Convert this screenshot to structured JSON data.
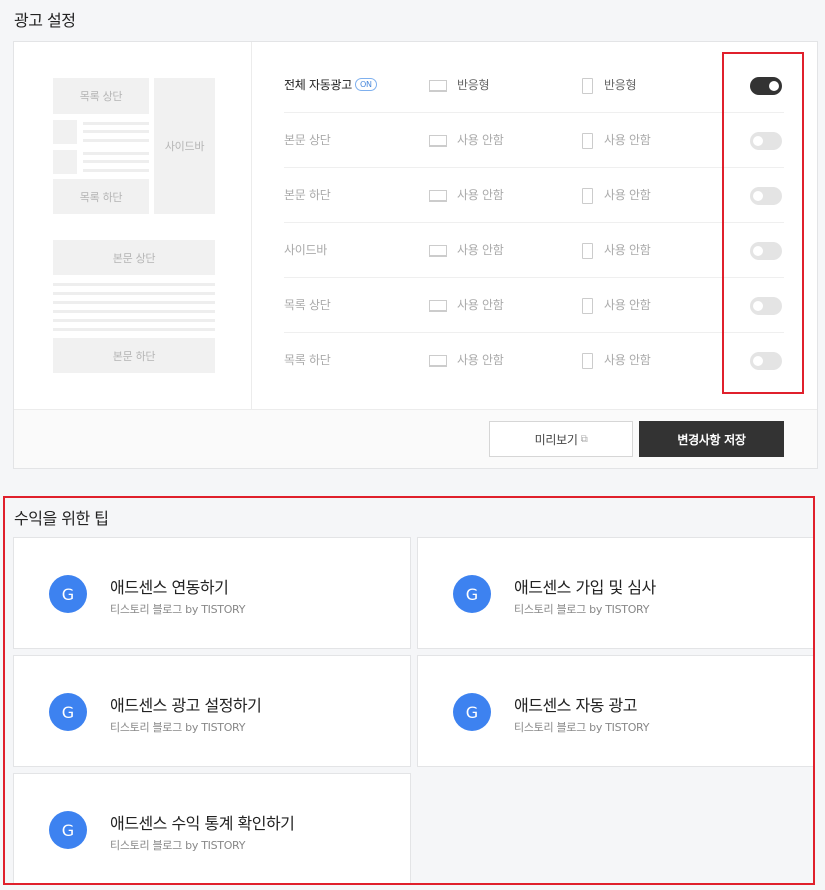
{
  "ad_settings": {
    "title": "광고 설정",
    "preview": {
      "list_top": "목록 상단",
      "list_bottom": "목록 하단",
      "sidebar": "사이드바",
      "body_top": "본문 상단",
      "body_bottom": "본문 하단"
    },
    "rows": [
      {
        "label": "전체 자동광고",
        "badge": "ON",
        "pc": "반응형",
        "mobile": "반응형",
        "enabled": true
      },
      {
        "label": "본문 상단",
        "pc": "사용 안함",
        "mobile": "사용 안함",
        "enabled": false
      },
      {
        "label": "본문 하단",
        "pc": "사용 안함",
        "mobile": "사용 안함",
        "enabled": false
      },
      {
        "label": "사이드바",
        "pc": "사용 안함",
        "mobile": "사용 안함",
        "enabled": false
      },
      {
        "label": "목록 상단",
        "pc": "사용 안함",
        "mobile": "사용 안함",
        "enabled": false
      },
      {
        "label": "목록 하단",
        "pc": "사용 안함",
        "mobile": "사용 안함",
        "enabled": false
      }
    ],
    "buttons": {
      "preview": "미리보기",
      "save": "변경사항 저장"
    }
  },
  "tips": {
    "title": "수익을 위한 팁",
    "items": [
      {
        "icon": "G",
        "title": "애드센스 연동하기",
        "source": "티스토리 블로그",
        "by": "by TISTORY"
      },
      {
        "icon": "G",
        "title": "애드센스 가입 및 심사",
        "source": "티스토리 블로그",
        "by": "by TISTORY"
      },
      {
        "icon": "G",
        "title": "애드센스 광고 설정하기",
        "source": "티스토리 블로그",
        "by": "by TISTORY"
      },
      {
        "icon": "G",
        "title": "애드센스 자동 광고",
        "source": "티스토리 블로그",
        "by": "by TISTORY"
      },
      {
        "icon": "G",
        "title": "애드센스 수익 통계 확인하기",
        "source": "티스토리 블로그",
        "by": "by TISTORY"
      }
    ]
  },
  "colors": {
    "background": "#f5f6f8",
    "toggle_on": "#333333",
    "toggle_off": "#e4e4e4",
    "save_button": "#333333",
    "google_icon": "#3d82f0",
    "highlight": "#e0202c"
  },
  "icons": {
    "pc": "monitor-icon",
    "mobile": "phone-icon",
    "external": "external-link-icon",
    "tip": "google-icon"
  }
}
